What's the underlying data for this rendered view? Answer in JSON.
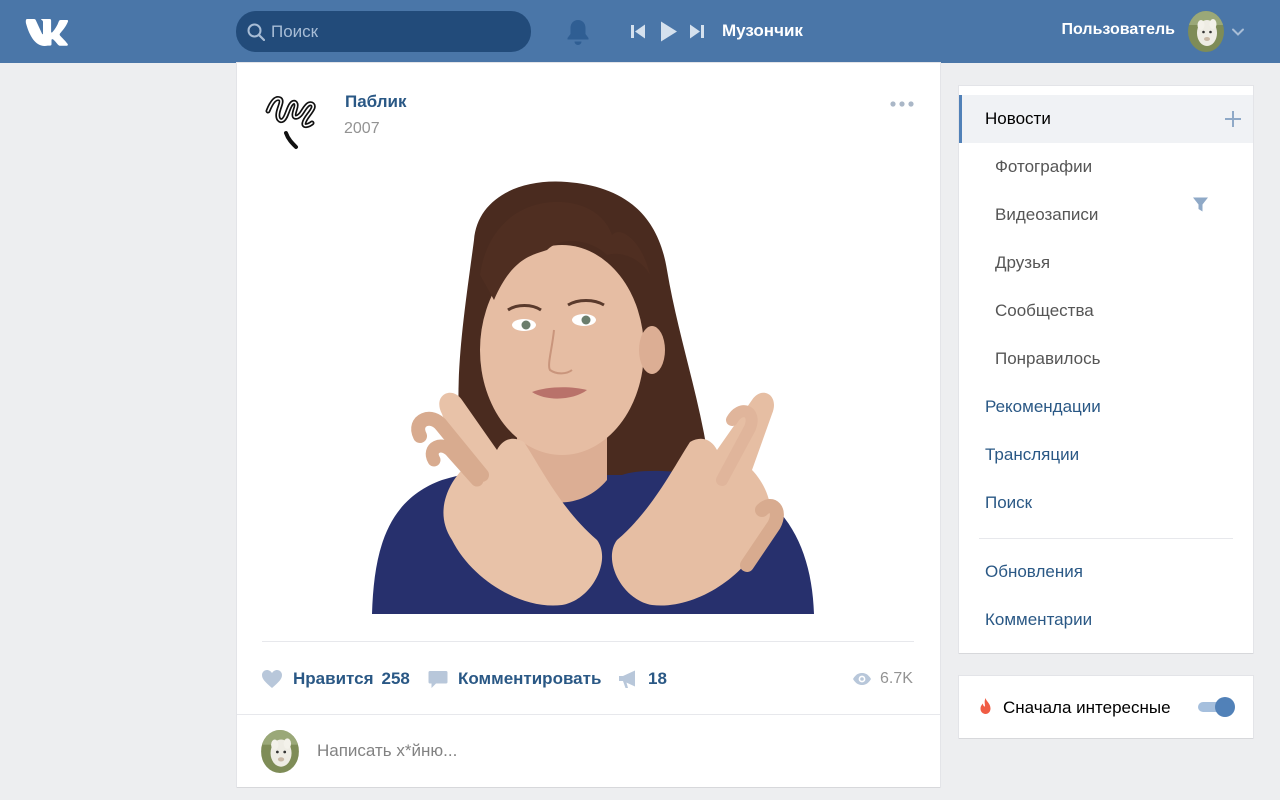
{
  "header": {
    "logo": "VK",
    "search_placeholder": "Поиск",
    "player_track": "Музончик",
    "user_name": "Пользователь",
    "bg_color": "#4a76a8"
  },
  "post": {
    "author": "Паблик",
    "date": "2007",
    "likes_label": "Нравится",
    "likes_count": "258",
    "comment_label": "Комментировать",
    "shares_count": "18",
    "views_count": "6.7K",
    "comment_placeholder": "Написать х*йню..."
  },
  "menu": {
    "active": "Новости",
    "sub_items": [
      "Фотографии",
      "Видеозаписи",
      "Друзья",
      "Сообщества",
      "Понравилось"
    ],
    "items": [
      "Рекомендации",
      "Трансляции",
      "Поиск"
    ],
    "bottom_items": [
      "Обновления",
      "Комментарии"
    ]
  },
  "toggle": {
    "label": "Сначала интересные",
    "on": true
  },
  "icons": [
    "vk-logo",
    "search-icon",
    "bell-icon",
    "prev-icon",
    "play-icon",
    "next-icon",
    "chevron-down-icon",
    "more-icon",
    "heart-icon",
    "comment-icon",
    "megaphone-icon",
    "eye-icon",
    "filter-icon",
    "plus-icon",
    "fire-icon"
  ]
}
